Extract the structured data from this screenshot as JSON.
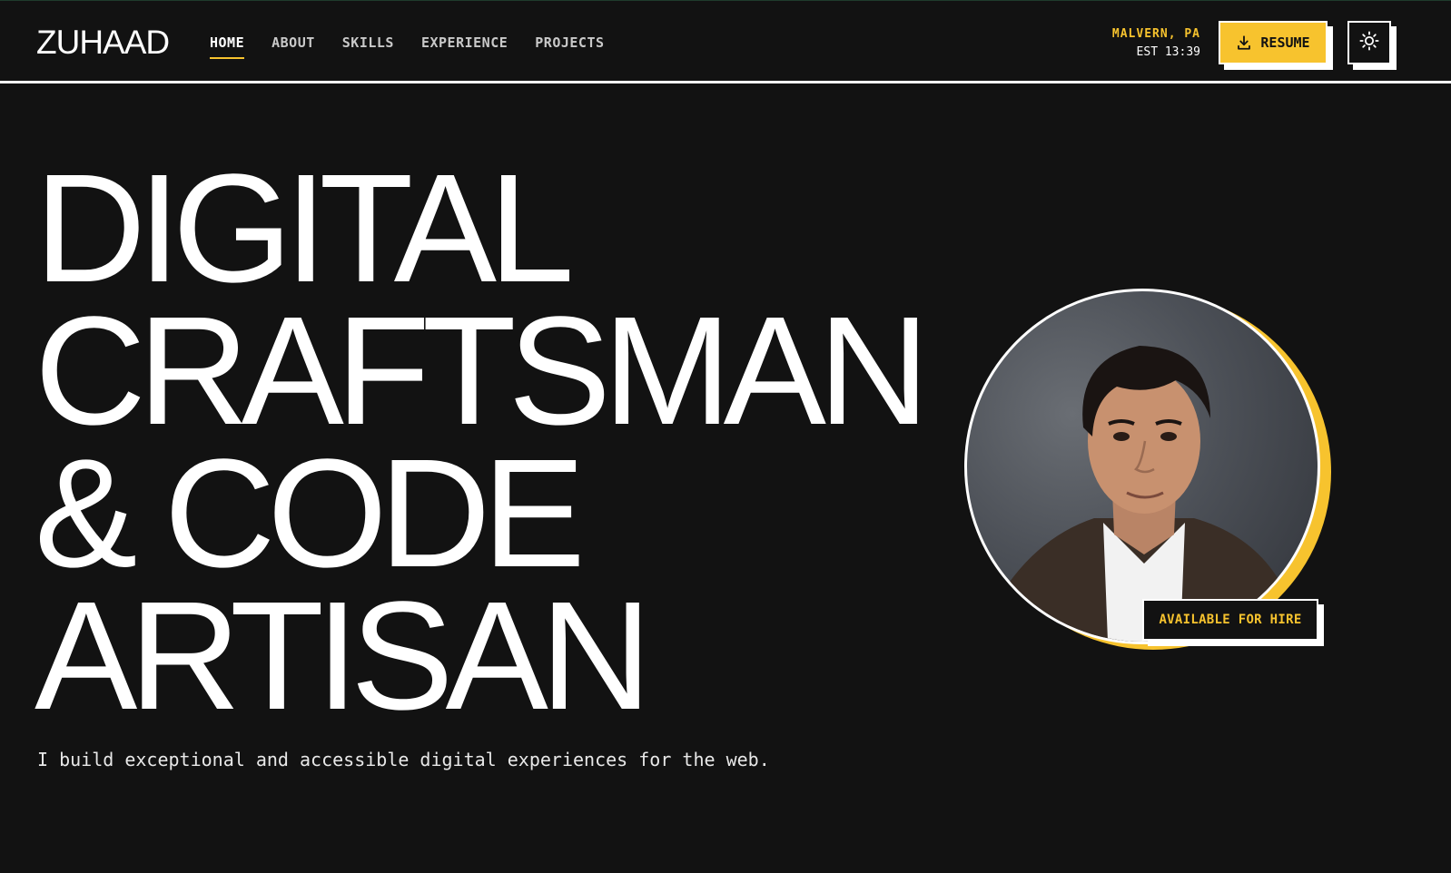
{
  "brand": {
    "logo": "ZUHAAD",
    "accent_color": "#f7c32e",
    "background_color": "#121212"
  },
  "nav": {
    "items": [
      {
        "label": "HOME",
        "active": true
      },
      {
        "label": "ABOUT",
        "active": false
      },
      {
        "label": "SKILLS",
        "active": false
      },
      {
        "label": "EXPERIENCE",
        "active": false
      },
      {
        "label": "PROJECTS",
        "active": false
      }
    ]
  },
  "locale": {
    "city": "MALVERN, PA",
    "time": "EST 13:39"
  },
  "actions": {
    "resume_label": "RESUME",
    "resume_icon": "download-icon",
    "theme_icon": "sun-icon"
  },
  "hero": {
    "title_lines": [
      "DIGITAL",
      "CRAFTSMAN",
      "& CODE",
      "ARTISAN"
    ],
    "tagline": "I build exceptional and accessible digital experiences for the web.",
    "badge": "AVAILABLE FOR HIRE"
  }
}
